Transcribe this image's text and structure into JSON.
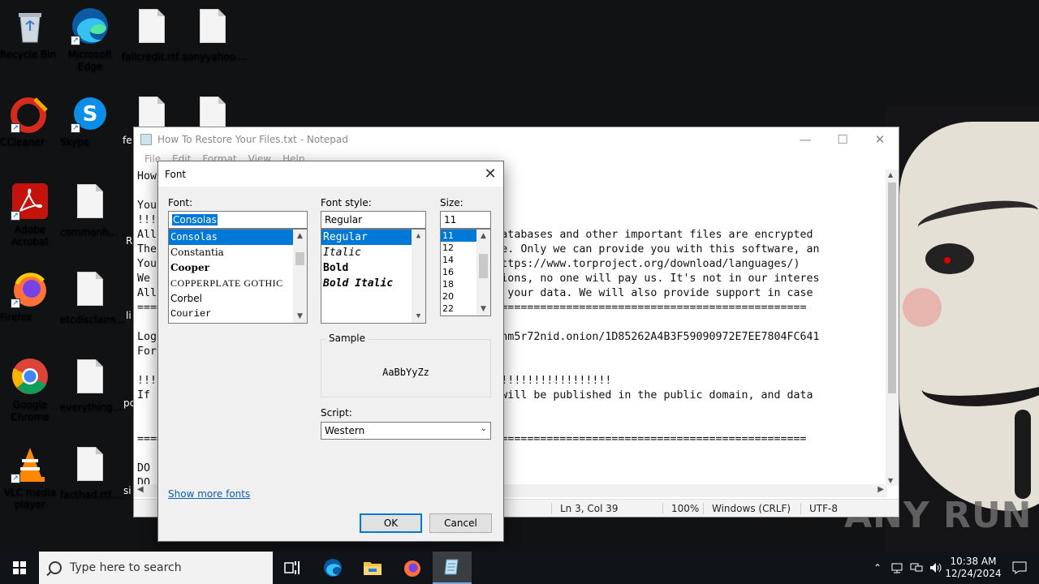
{
  "desktop": {
    "icons": [
      {
        "label": "Recycle Bin"
      },
      {
        "label": "Microsoft Edge"
      },
      {
        "label": "fallcredit.rtf..."
      },
      {
        "label": "sonyyahoo...."
      },
      {
        "label": "CCleaner"
      },
      {
        "label": "Skype"
      },
      {
        "label": "Adobe Acrobat"
      },
      {
        "label": "commonh..."
      },
      {
        "label": "Firefox"
      },
      {
        "label": "etcdisclaim..."
      },
      {
        "label": "Google Chrome"
      },
      {
        "label": "everything..."
      },
      {
        "label": "VLC media player"
      },
      {
        "label": "facthad.rtf...."
      }
    ],
    "partial_labels": [
      "fe",
      "R",
      "li",
      "pc",
      "si"
    ],
    "watermark": "ANY RUN"
  },
  "notepad": {
    "title": "How To Restore Your Files.txt - Notepad",
    "menu": [
      "File",
      "Edit",
      "Format",
      "View",
      "Help"
    ],
    "text_lines": [
      "How",
      "",
      "Your",
      "!!!",
      "All                                           ee data, databases and other important files are encrypted",
      "The                                           ed software. Only we can provide you with this software, an",
      "You                                           browser (https://www.torproject.org/download/languages/)",
      "We                                            nd obligations, no one will pay us. It's not in our interes",
      "All                                           ll decrypt your data. We will also provide support in case",
      "====                                          =========================================================",
      "",
      "Log                                           uni7hqcqt7hm5r72nid.onion/1D85262A4B3F59090972E7EE7804FC641",
      "For",
      "",
      "!!!                                           !!!!!!!!!!!!!!!!!!!!!!!!!!!",
      "If                                            your data will be published in the public domain, and data",
      "",
      "",
      "====                                          =========================================================",
      "",
      "DO",
      "DO"
    ],
    "status": {
      "position": "Ln 3, Col 39",
      "zoom": "100%",
      "line_ending": "Windows (CRLF)",
      "encoding": "UTF-8"
    }
  },
  "font_dialog": {
    "title": "Font",
    "font_label": "Font:",
    "font_value": "Consolas",
    "fonts": [
      "Consolas",
      "Constantia",
      "Cooper",
      "COPPERPLATE GOTHIC",
      "Corbel",
      "Courier"
    ],
    "style_label": "Font style:",
    "style_value": "Regular",
    "styles": [
      "Regular",
      "Italic",
      "Bold",
      "Bold Italic"
    ],
    "size_label": "Size:",
    "size_value": "11",
    "sizes": [
      "11",
      "12",
      "14",
      "16",
      "18",
      "20",
      "22"
    ],
    "sample_label": "Sample",
    "sample_text": "AaBbYyZz",
    "script_label": "Script:",
    "script_value": "Western",
    "show_more": "Show more fonts",
    "ok": "OK",
    "cancel": "Cancel"
  },
  "taskbar": {
    "search_placeholder": "Type here to search",
    "time": "10:38 AM",
    "date": "12/24/2024"
  }
}
